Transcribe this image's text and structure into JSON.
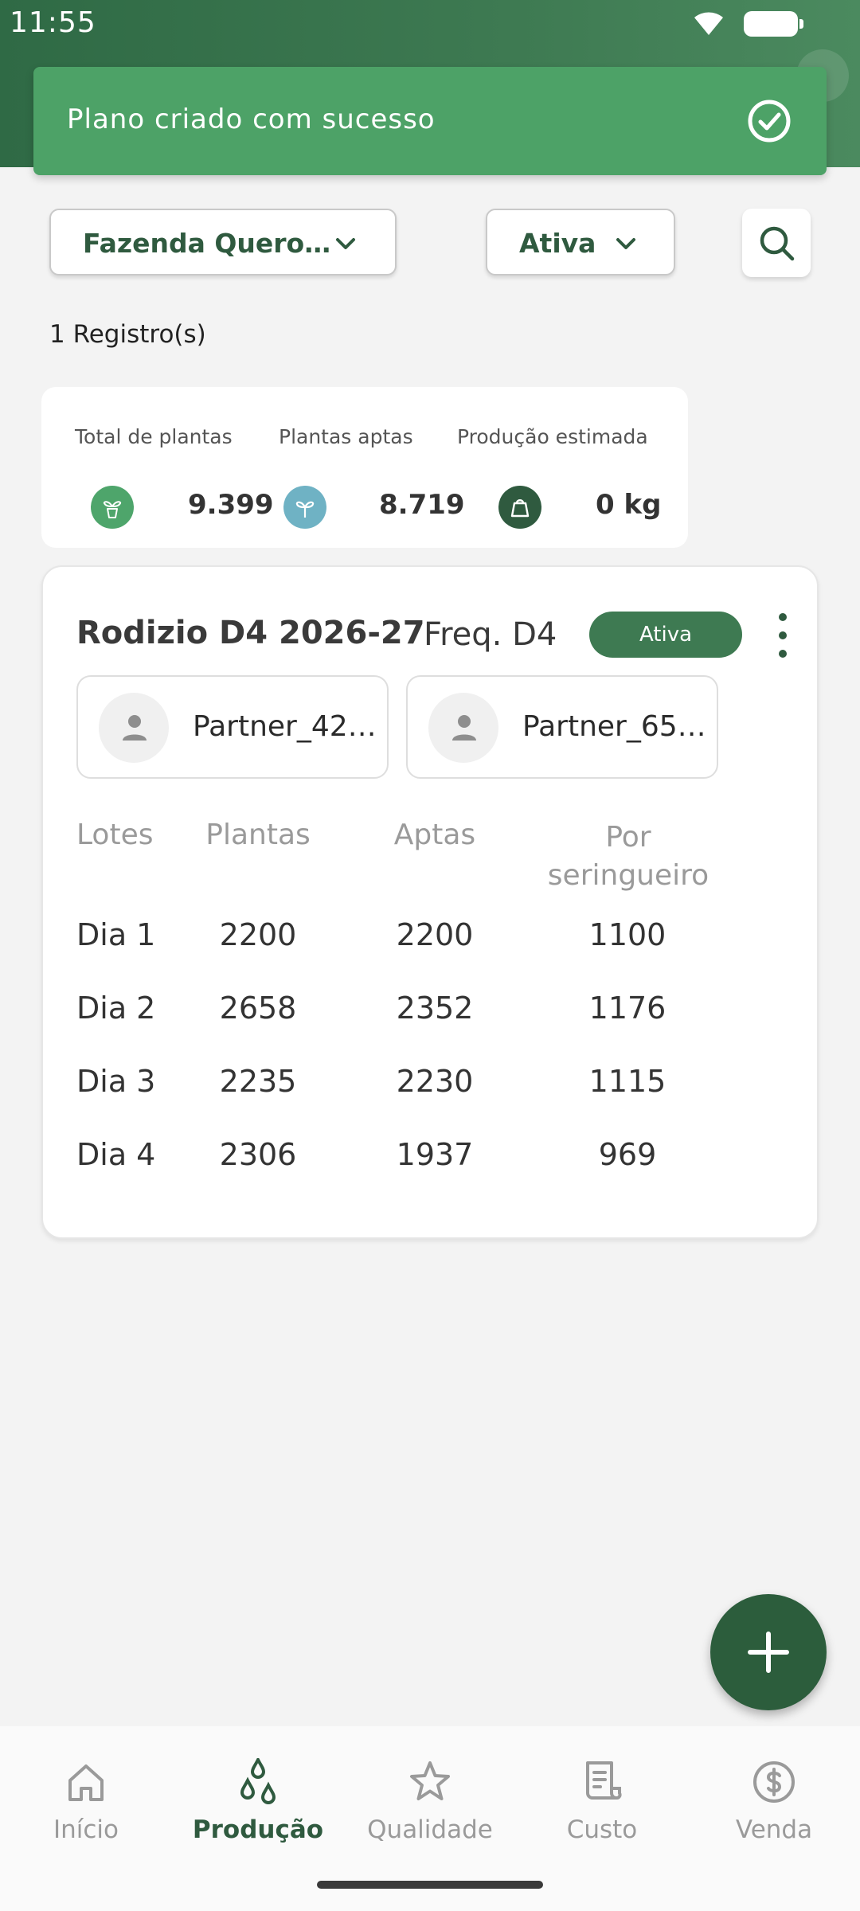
{
  "status_bar": {
    "time": "11:55"
  },
  "snackbar": {
    "message": "Plano criado com sucesso"
  },
  "filters": {
    "farm": "Fazenda Quero…",
    "status": "Ativa"
  },
  "records_count": "1 Registro(s)",
  "summary": {
    "total_label": "Total de plantas",
    "total_value": "9.399",
    "aptas_label": "Plantas aptas",
    "aptas_value": "8.719",
    "producao_label": "Produção estimada",
    "producao_value": "0 kg"
  },
  "plan": {
    "title": "Rodizio D4 2026-27",
    "freq": "Freq. D4",
    "status": "Ativa",
    "partners": [
      "Partner_42…",
      "Partner_65…"
    ],
    "columns": [
      "Lotes",
      "Plantas",
      "Aptas",
      "Por seringueiro"
    ],
    "rows": [
      {
        "lote": "Dia 1",
        "plantas": "2200",
        "aptas": "2200",
        "por": "1100"
      },
      {
        "lote": "Dia 2",
        "plantas": "2658",
        "aptas": "2352",
        "por": "1176"
      },
      {
        "lote": "Dia 3",
        "plantas": "2235",
        "aptas": "2230",
        "por": "1115"
      },
      {
        "lote": "Dia 4",
        "plantas": "2306",
        "aptas": "1937",
        "por": "969"
      }
    ]
  },
  "bottom_nav": [
    {
      "label": "Início",
      "icon": "home-icon",
      "active": false
    },
    {
      "label": "Produção",
      "icon": "drops-icon",
      "active": true
    },
    {
      "label": "Qualidade",
      "icon": "star-icon",
      "active": false
    },
    {
      "label": "Custo",
      "icon": "receipt-icon",
      "active": false
    },
    {
      "label": "Venda",
      "icon": "dollar-coin-icon",
      "active": false
    }
  ],
  "colors": {
    "primary_dark": "#2f5a3f",
    "header": "#3e7a52",
    "snackbar": "#4da267",
    "badge": "#3e7a52"
  }
}
